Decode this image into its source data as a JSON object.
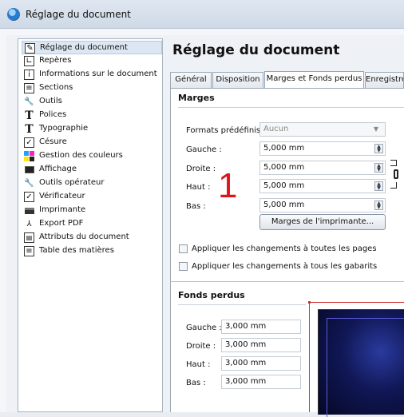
{
  "window": {
    "title": "Réglage du document"
  },
  "sidebar": {
    "items": [
      {
        "label": "Réglage du document",
        "icon": "document-settings-icon",
        "selected": true
      },
      {
        "label": "Repères",
        "icon": "guides-icon"
      },
      {
        "label": "Informations sur le document",
        "icon": "info-icon"
      },
      {
        "label": "Sections",
        "icon": "sections-icon"
      },
      {
        "label": "Outils",
        "icon": "wrench-icon"
      },
      {
        "label": "Polices",
        "icon": "font-T-icon"
      },
      {
        "label": "Typographie",
        "icon": "typography-T-icon"
      },
      {
        "label": "Césure",
        "icon": "checkbox-icon"
      },
      {
        "label": "Gestion des couleurs",
        "icon": "color-squares-icon"
      },
      {
        "label": "Affichage",
        "icon": "monitor-icon"
      },
      {
        "label": "Outils opérateur",
        "icon": "wrench-icon"
      },
      {
        "label": "Vérificateur",
        "icon": "checkbox-icon"
      },
      {
        "label": "Imprimante",
        "icon": "printer-icon"
      },
      {
        "label": "Export PDF",
        "icon": "export-pdf-icon"
      },
      {
        "label": "Attributs du document",
        "icon": "attributes-icon"
      },
      {
        "label": "Table des matières",
        "icon": "toc-icon"
      }
    ]
  },
  "main": {
    "heading": "Réglage du document",
    "tabs": [
      {
        "label": "Général"
      },
      {
        "label": "Disposition"
      },
      {
        "label": "Marges et Fonds perdus",
        "active": true
      },
      {
        "label": "Enregistre"
      }
    ],
    "margins": {
      "title": "Marges",
      "presets_label": "Formats prédéfinis :",
      "presets_value": "Aucun",
      "fields": [
        {
          "label": "Gauche :",
          "value": "5,000 mm"
        },
        {
          "label": "Droite :",
          "value": "5,000 mm"
        },
        {
          "label": "Haut :",
          "value": "5,000 mm"
        },
        {
          "label": "Bas :",
          "value": "5,000 mm"
        }
      ],
      "printer_margins_button": "Marges de l'imprimante...",
      "apply_all_pages": "Appliquer les changements à toutes les pages",
      "apply_all_masters": "Appliquer les changements à tous les gabarits",
      "annotation": "1"
    },
    "bleeds": {
      "title": "Fonds perdus",
      "fields": [
        {
          "label": "Gauche :",
          "value": "3,000 mm"
        },
        {
          "label": "Droite :",
          "value": "3,000 mm"
        },
        {
          "label": "Haut :",
          "value": "3,000 mm"
        },
        {
          "label": "Bas :",
          "value": "3,000 mm"
        }
      ]
    }
  },
  "colors": {
    "annotation": "#e0141a",
    "selection": "#dde7f3",
    "preview_dark": "#101755"
  }
}
